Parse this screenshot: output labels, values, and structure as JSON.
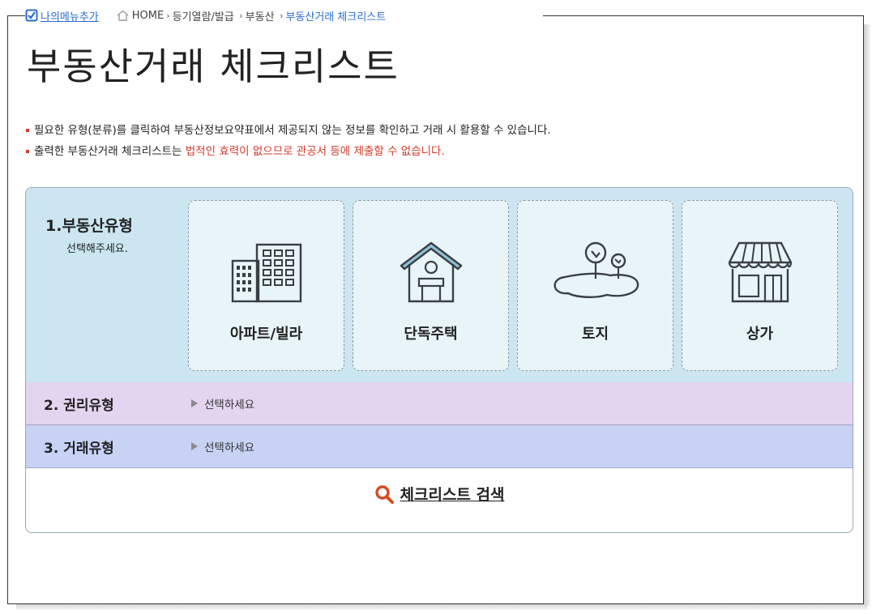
{
  "breadcrumb": {
    "my_menu": "나의메뉴추가",
    "items": [
      "HOME",
      "등기열람/발급",
      "부동산",
      "부동산거래 체크리스트"
    ]
  },
  "page_title": "부동산거래 체크리스트",
  "notes": {
    "note1": "필요한 유형(분류)를 클릭하여 부동산정보요약표에서 제공되지 않는 정보를 확인하고 거래 시 활용할 수 있습니다.",
    "note2_prefix": "출력한 부동산거래 체크리스트는 ",
    "note2_highlight": "법적인 효력이 없으므로 관공서 등에 제출할 수 없습니다."
  },
  "section1": {
    "label": "1.부동산유형",
    "sublabel": "선택해주세요.",
    "cards": [
      {
        "label": "아파트/빌라",
        "icon": "apartment-icon"
      },
      {
        "label": "단독주택",
        "icon": "house-icon"
      },
      {
        "label": "토지",
        "icon": "land-icon"
      },
      {
        "label": "상가",
        "icon": "store-icon"
      }
    ]
  },
  "section2": {
    "label": "2. 권리유형",
    "select": "선택하세요"
  },
  "section3": {
    "label": "3. 거래유형",
    "select": "선택하세요"
  },
  "search": {
    "label": "체크리스트 검색"
  },
  "colors": {
    "link_blue": "#2a6dd1",
    "warning_red": "#d23a2a",
    "section1_bg": "#cbe6f0",
    "section2_bg": "#e3d4f0",
    "section3_bg": "#c7d2f5",
    "search_icon": "#d64a1f"
  }
}
